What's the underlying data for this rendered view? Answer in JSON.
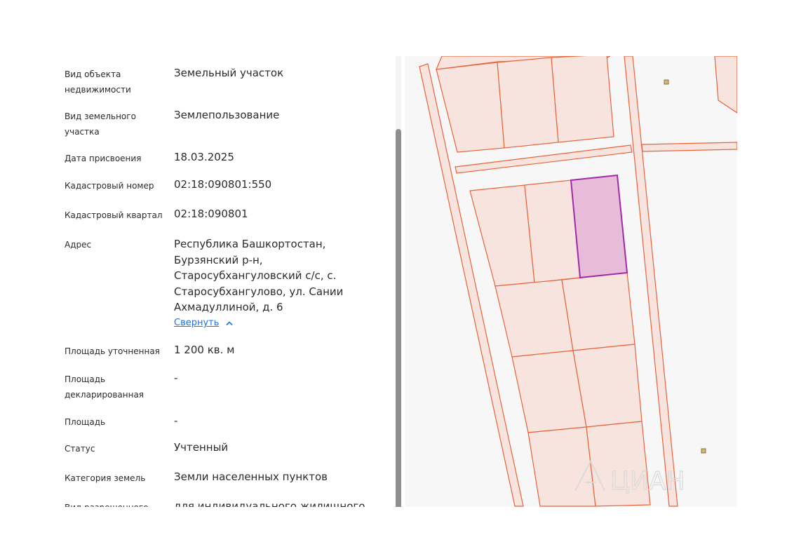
{
  "fields": [
    {
      "label": "Вид объекта недвижимости",
      "value": "Земельный участок"
    },
    {
      "label": "Вид земельного участка",
      "value": "Землепользование"
    },
    {
      "label": "Дата присвоения",
      "value": "18.03.2025"
    },
    {
      "label": "Кадастровый номер",
      "value": "02:18:090801:550"
    },
    {
      "label": "Кадастровый квартал",
      "value": "02:18:090801"
    },
    {
      "label": "Адрес",
      "value": "Республика Башкортостан, Бурзянский р-н, Старосубхангуловский с/с, с. Старосубхангулово, ул. Сании Ахмадуллиной, д. 6"
    },
    {
      "label": "Площадь уточненная",
      "value": "1 200 кв. м"
    },
    {
      "label": "Площадь декларированная",
      "value": "-"
    },
    {
      "label": "Площадь",
      "value": "-"
    },
    {
      "label": "Статус",
      "value": "Учтенный"
    },
    {
      "label": "Категория земель",
      "value": "Земли населенных пунктов"
    },
    {
      "label": "Вид разрешенного использования",
      "value": "для индивидуального жилищного строительства"
    }
  ],
  "address_toggle": "Свернуть",
  "map": {
    "parcel_stroke": "#e8643a",
    "parcel_fill": "#f7e4df",
    "selected_stroke": "#a22aa8",
    "selected_fill": "#e6bcd9",
    "background": "#f7f7f7"
  },
  "watermark": {
    "icon": "cian-logo-icon",
    "text": "ЦИАН"
  }
}
